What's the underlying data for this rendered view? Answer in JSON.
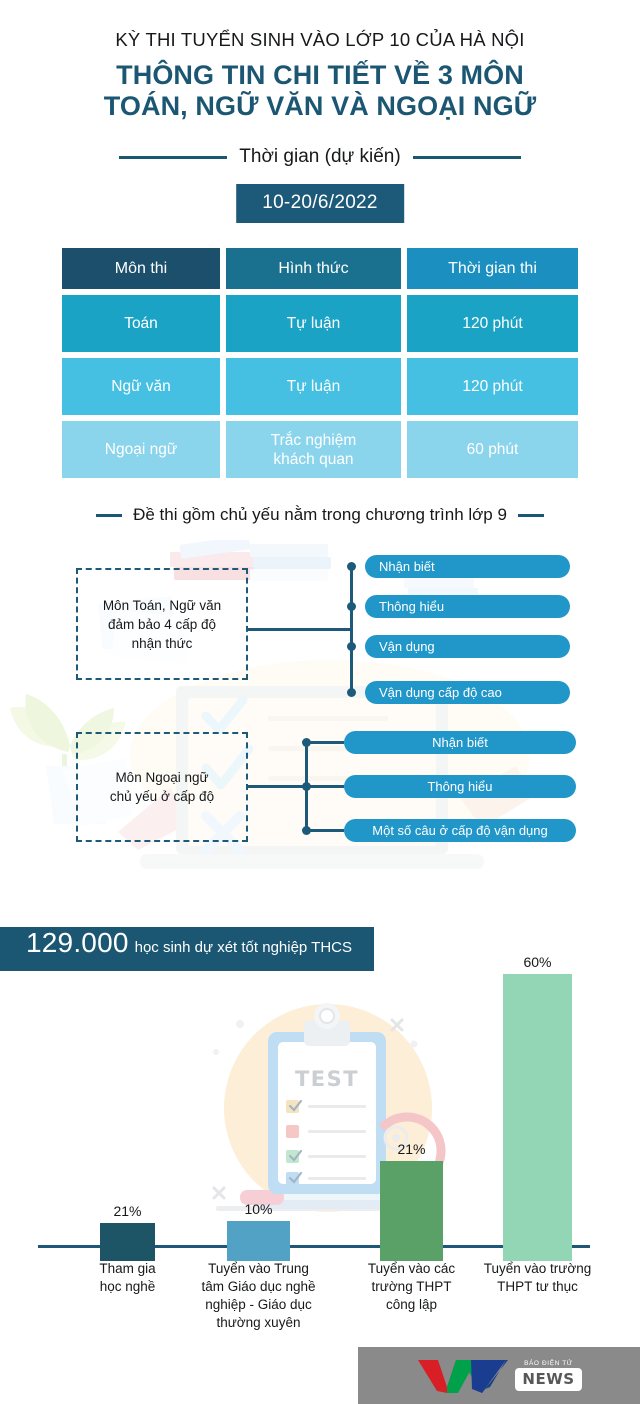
{
  "header": {
    "eyebrow": "KỲ THI TUYỂN SINH VÀO LỚP 10 CỦA HÀ NỘI",
    "title_line1": "THÔNG TIN CHI TIẾT VỀ 3 MÔN",
    "title_line2": "TOÁN, NGỮ VĂN VÀ NGOẠI NGỮ",
    "divider_label": "Thời gian (dự kiến)",
    "date_badge": "10-20/6/2022",
    "accent_color": "#1b5773"
  },
  "table": {
    "headers": [
      "Môn thi",
      "Hình thức",
      "Thời gian thi"
    ],
    "rows": [
      {
        "subject": "Toán",
        "format": "Tự luận",
        "duration": "120 phút"
      },
      {
        "subject": "Ngữ văn",
        "format": "Tự luận",
        "duration": "120 phút"
      },
      {
        "subject": "Ngoại ngữ",
        "format": "Trắc nghiệm\nkhách quan",
        "duration": "60 phút"
      }
    ],
    "header_colors": [
      "#1b4f6b",
      "#19718f",
      "#1b8fc0"
    ],
    "row_colors": [
      "#1aa3c4",
      "#45c0e2",
      "#8ad4ec"
    ]
  },
  "diagram": {
    "section_title": "Đề thi gồm chủ yếu nằm trong chương trình lớp 9",
    "groups": [
      {
        "box_label": "Môn Toán, Ngữ văn\nđảm bảo 4 cấp độ\nnhận thức",
        "items": [
          "Nhận biết",
          "Thông hiểu",
          "Vận dụng",
          "Vận dụng cấp độ cao"
        ]
      },
      {
        "box_label": "Môn Ngoại ngữ\nchủ yếu ở cấp độ",
        "items": [
          "Nhận biết",
          "Thông hiểu",
          "Một số câu ở cấp độ vận dụng"
        ]
      }
    ],
    "pill_color": "#2196c9",
    "line_color": "#1d5a79"
  },
  "stats": {
    "banner_number": "129.000",
    "banner_text": "học sinh dự xét tốt nghiệp THCS"
  },
  "chart_data": {
    "type": "bar",
    "title": "129.000 học sinh dự xét tốt nghiệp THCS",
    "xlabel": "",
    "ylabel": "",
    "ylim": [
      0,
      60
    ],
    "grid": false,
    "legend": "none",
    "categories": [
      "Tham gia\nhọc nghề",
      "Tuyển vào Trung\ntâm Giáo dục nghề\nnghiệp - Giáo dục\nthường xuyên",
      "Tuyển vào các\ntrường THPT\ncông lập",
      "Tuyển vào trường\nTHPT tư thục"
    ],
    "values": [
      21,
      10,
      21,
      60
    ],
    "value_labels": [
      "21%",
      "10%",
      "21%",
      "60%"
    ],
    "bar_colors": [
      "#1d5567",
      "#52a2c6",
      "#5aa167",
      "#92d6b6"
    ],
    "bar_pixel_heights": [
      38,
      40,
      100,
      287
    ],
    "bar_pixel_lefts": [
      100,
      227,
      380,
      503
    ],
    "bar_pixel_widths": [
      55,
      63,
      63,
      69
    ],
    "axis_color": "#1f5778"
  },
  "footer": {
    "logo_v1": "V",
    "logo_t": "T",
    "logo_v2": "V",
    "tagline": "BÁO ĐIỆN TỬ",
    "news": "NEWS",
    "bg_color": "#8a8a8a"
  }
}
